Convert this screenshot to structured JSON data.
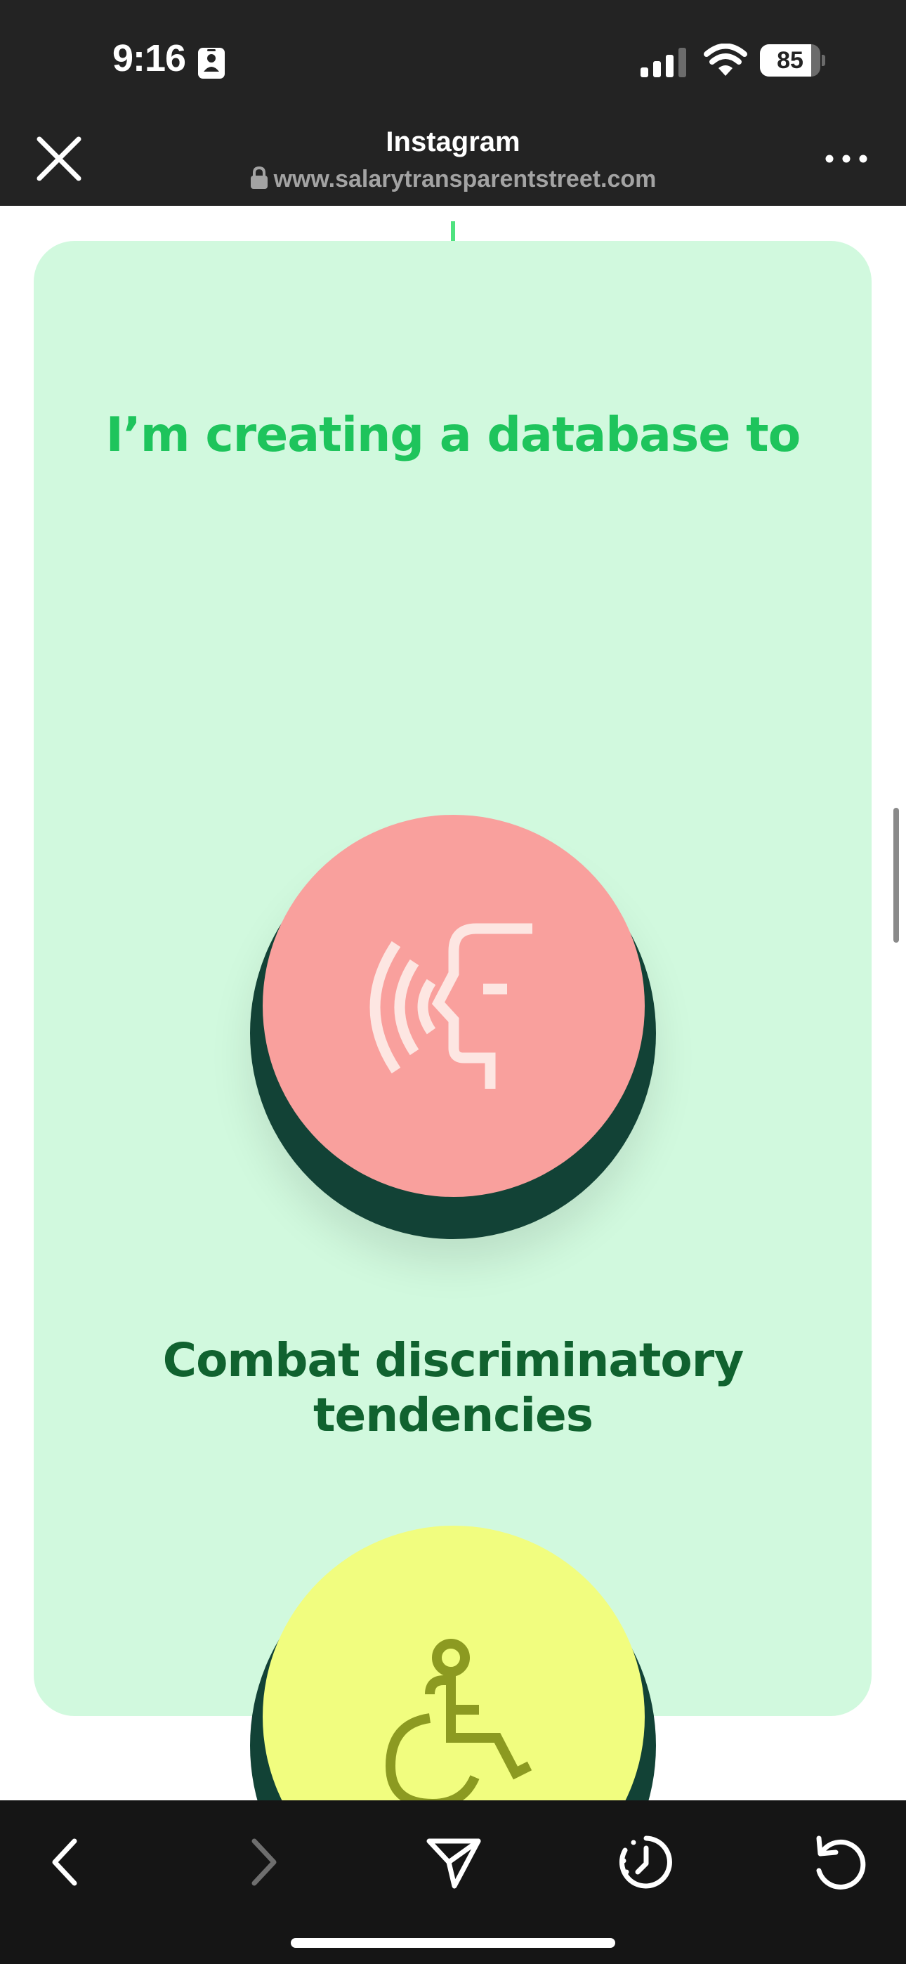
{
  "status_bar": {
    "time": "9:16",
    "battery_percent": "85",
    "battery_level": 0.85,
    "signal_bars": 3,
    "icons": [
      "contact-card-icon",
      "cellular-signal-icon",
      "wifi-icon",
      "battery-icon"
    ]
  },
  "browser_header": {
    "title": "Instagram",
    "url": "www.salarytransparentstreet.com",
    "close_icon": "close-icon",
    "more_icon": "more-options-icon"
  },
  "page": {
    "heading": "I’m creating a database to",
    "items": [
      {
        "caption_line1": "Combat discriminatory",
        "caption_line2": "tendencies",
        "icon": "speaking-head-icon",
        "circle_color": "#f9a09d"
      },
      {
        "icon": "wheelchair-accessibility-icon",
        "circle_color": "#f1fd7f"
      }
    ],
    "colors": {
      "card_background": "#d1f9de",
      "heading": "#1ec45c",
      "caption": "#10622f",
      "circle_shadow": "#124236",
      "arrow": "#4fe27f"
    }
  },
  "toolbar": {
    "items": [
      {
        "icon": "back-chevron-icon",
        "enabled": true
      },
      {
        "icon": "forward-chevron-icon",
        "enabled": false
      },
      {
        "icon": "share-paper-plane-icon",
        "enabled": true
      },
      {
        "icon": "history-clock-icon",
        "enabled": true
      },
      {
        "icon": "reload-icon",
        "enabled": true
      }
    ]
  }
}
